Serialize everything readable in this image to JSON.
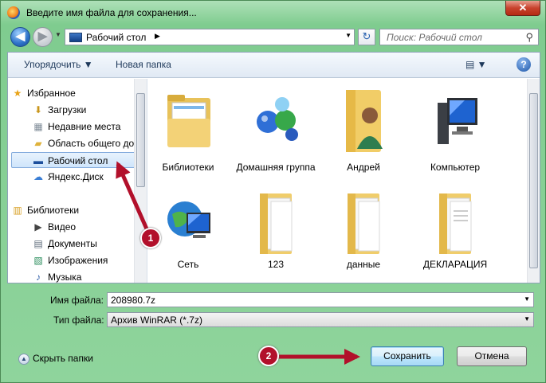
{
  "window": {
    "title": "Введите имя файла для сохранения...",
    "close_label": "✕"
  },
  "nav": {
    "back_glyph": "◀",
    "forward_glyph": "▶",
    "history_glyph": "▼",
    "refresh_glyph": "↻"
  },
  "address": {
    "location": "Рабочий стол",
    "separator": "▶",
    "dropdown": "▼"
  },
  "search": {
    "placeholder": "Поиск: Рабочий стол",
    "icon": "⚲"
  },
  "toolbar": {
    "organize": "Упорядочить ▼",
    "new_folder": "Новая папка",
    "views": "▤ ▼",
    "help": "?"
  },
  "sidebar": {
    "items": [
      {
        "label": "Избранное",
        "glyph": "★"
      },
      {
        "label": "Загрузки",
        "glyph": "⬇"
      },
      {
        "label": "Недавние места",
        "glyph": "▦"
      },
      {
        "label": "Область общего до",
        "glyph": "▰"
      },
      {
        "label": "Рабочий стол",
        "glyph": "▬"
      },
      {
        "label": "Яндекс.Диск",
        "glyph": "☁"
      },
      {
        "label": "Библиотеки",
        "glyph": "▥"
      },
      {
        "label": "Видео",
        "glyph": "▶"
      },
      {
        "label": "Документы",
        "glyph": "▤"
      },
      {
        "label": "Изображения",
        "glyph": "▧"
      },
      {
        "label": "Музыка",
        "glyph": "♪"
      }
    ]
  },
  "files": [
    {
      "label": "Библиотеки"
    },
    {
      "label": "Домашняя группа"
    },
    {
      "label": "Андрей"
    },
    {
      "label": "Компьютер"
    },
    {
      "label": "Сеть"
    },
    {
      "label": "123"
    },
    {
      "label": "данные"
    },
    {
      "label": "ДЕКЛАРАЦИЯ"
    }
  ],
  "form": {
    "filename_label": "Имя файла:",
    "filename_value": "208980.7z",
    "filetype_label": "Тип файла:",
    "filetype_value": "Архив WinRAR (*.7z)"
  },
  "footer": {
    "hide_folders": "Скрыть папки",
    "save": "Сохранить",
    "cancel": "Отмена"
  },
  "annotations": {
    "badge1": "1",
    "badge2": "2",
    "color": "#b2102b"
  }
}
